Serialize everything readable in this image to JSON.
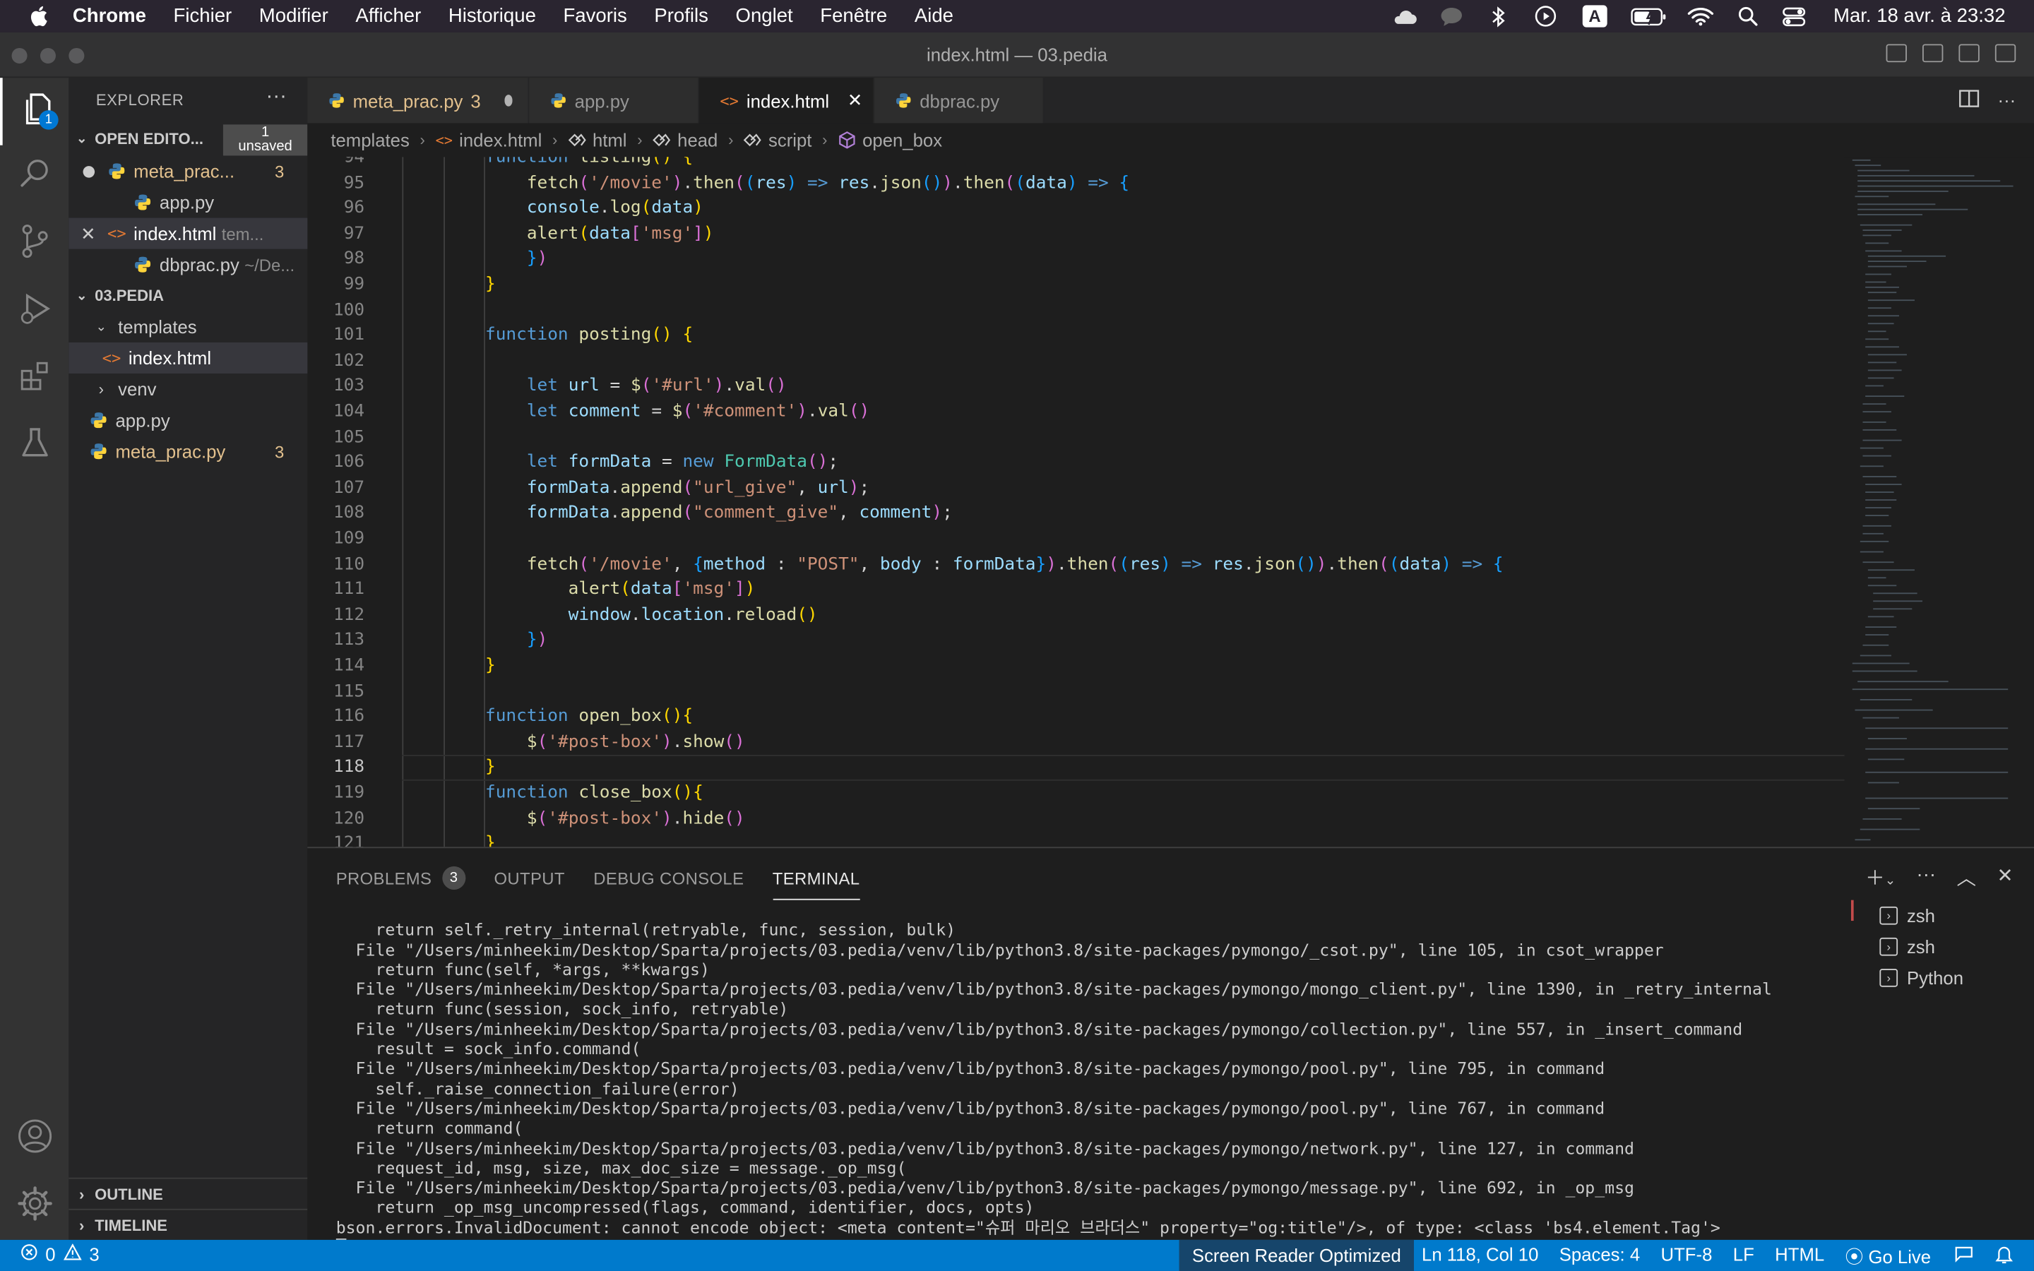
{
  "menubar": {
    "app": "Chrome",
    "items": [
      "Fichier",
      "Modifier",
      "Afficher",
      "Historique",
      "Favoris",
      "Profils",
      "Onglet",
      "Fenêtre",
      "Aide"
    ],
    "status_icons": [
      "cloud-icon",
      "chat-icon",
      "bluetooth-icon",
      "play-icon",
      "input-source-icon",
      "battery-icon",
      "wifi-icon",
      "search-icon",
      "control-center-icon"
    ],
    "input_source": "A",
    "clock": "Mar. 18 avr. à 23:32"
  },
  "window": {
    "title": "index.html — 03.pedia"
  },
  "activity_bar": {
    "explorer_badge": "1"
  },
  "sidebar": {
    "title": "EXPLORER",
    "open_editors": {
      "label": "OPEN EDITO...",
      "unsaved_line1": "1",
      "unsaved_line2": "unsaved",
      "files": [
        {
          "name": "meta_prac...",
          "count": "3",
          "hint": ""
        },
        {
          "name": "app.py",
          "count": "",
          "hint": ""
        },
        {
          "name": "index.html",
          "count": "",
          "hint": "tem..."
        },
        {
          "name": "dbprac.py",
          "count": "",
          "hint": "~/De..."
        }
      ]
    },
    "project": {
      "label": "03.PEDIA",
      "items": [
        {
          "name": "templates"
        },
        {
          "name": "index.html"
        },
        {
          "name": "venv"
        },
        {
          "name": "app.py"
        },
        {
          "name": "meta_prac.py",
          "count": "3"
        }
      ]
    },
    "outline": "OUTLINE",
    "timeline": "TIMELINE"
  },
  "tabs": [
    {
      "name": "meta_prac.py",
      "count": "3"
    },
    {
      "name": "app.py"
    },
    {
      "name": "index.html"
    },
    {
      "name": "dbprac.py"
    }
  ],
  "breadcrumbs": [
    "templates",
    "index.html",
    "html",
    "head",
    "script",
    "open_box"
  ],
  "code": {
    "line_numbers": [
      "94",
      "95",
      "96",
      "97",
      "98",
      "99",
      "100",
      "101",
      "102",
      "103",
      "104",
      "105",
      "106",
      "107",
      "108",
      "109",
      "110",
      "111",
      "112",
      "113",
      "114",
      "115",
      "116",
      "117",
      "118",
      "119",
      "120",
      "121"
    ],
    "current_line": "118"
  },
  "panel": {
    "tabs": [
      "PROBLEMS",
      "OUTPUT",
      "DEBUG CONSOLE",
      "TERMINAL"
    ],
    "problems_count": "3",
    "terminal_lines": [
      "    return self._retry_internal(retryable, func, session, bulk)",
      "  File \"/Users/minheekim/Desktop/Sparta/projects/03.pedia/venv/lib/python3.8/site-packages/pymongo/_csot.py\", line 105, in csot_wrapper",
      "    return func(self, *args, **kwargs)",
      "  File \"/Users/minheekim/Desktop/Sparta/projects/03.pedia/venv/lib/python3.8/site-packages/pymongo/mongo_client.py\", line 1390, in _retry_internal",
      "    return func(session, sock_info, retryable)",
      "  File \"/Users/minheekim/Desktop/Sparta/projects/03.pedia/venv/lib/python3.8/site-packages/pymongo/collection.py\", line 557, in _insert_command",
      "    result = sock_info.command(",
      "  File \"/Users/minheekim/Desktop/Sparta/projects/03.pedia/venv/lib/python3.8/site-packages/pymongo/pool.py\", line 795, in command",
      "    self._raise_connection_failure(error)",
      "  File \"/Users/minheekim/Desktop/Sparta/projects/03.pedia/venv/lib/python3.8/site-packages/pymongo/pool.py\", line 767, in command",
      "    return command(",
      "  File \"/Users/minheekim/Desktop/Sparta/projects/03.pedia/venv/lib/python3.8/site-packages/pymongo/network.py\", line 127, in command",
      "    request_id, msg, size, max_doc_size = message._op_msg(",
      "  File \"/Users/minheekim/Desktop/Sparta/projects/03.pedia/venv/lib/python3.8/site-packages/pymongo/message.py\", line 692, in _op_msg",
      "    return _op_msg_uncompressed(flags, command, identifier, docs, opts)",
      "bson.errors.InvalidDocument: cannot encode object: <meta content=\"슈퍼 마리오 브라더스\" property=\"og:title\"/>, of type: <class 'bs4.element.Tag'>"
    ],
    "terminals": [
      "zsh",
      "zsh",
      "Python"
    ]
  },
  "statusbar": {
    "errors": "0",
    "warnings": "3",
    "screen_reader": "Screen Reader Optimized",
    "position": "Ln 118, Col 10",
    "spaces": "Spaces: 4",
    "encoding": "UTF-8",
    "eol": "LF",
    "language": "HTML",
    "golive": "Go Live"
  },
  "colors": {
    "accent": "#007acc",
    "modified": "#e2c08d",
    "badge": "#0078d4"
  }
}
